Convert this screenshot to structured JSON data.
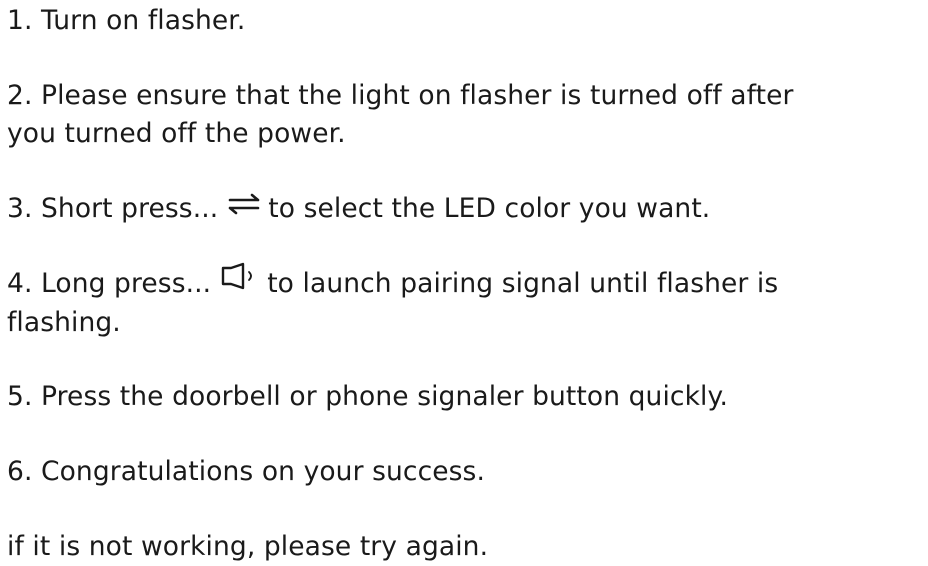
{
  "steps": [
    {
      "text": "1. Turn on flasher."
    },
    {
      "line1": "2. Please ensure that the light on flasher is turned off after",
      "line2": "you turned off the power."
    },
    {
      "before": "3. Short press...",
      "icon": "swap-arrows-icon",
      "after": "to select the LED color you want."
    },
    {
      "before": "4. Long press...",
      "icon": "speaker-icon",
      "after_line1": "to launch pairing signal until flasher is",
      "after_line2": "flashing."
    },
    {
      "text": "5. Press the doorbell or phone signaler button quickly."
    },
    {
      "text": "6. Congratulations on your success."
    }
  ],
  "footer": {
    "text": "if it is not working, please try again."
  }
}
